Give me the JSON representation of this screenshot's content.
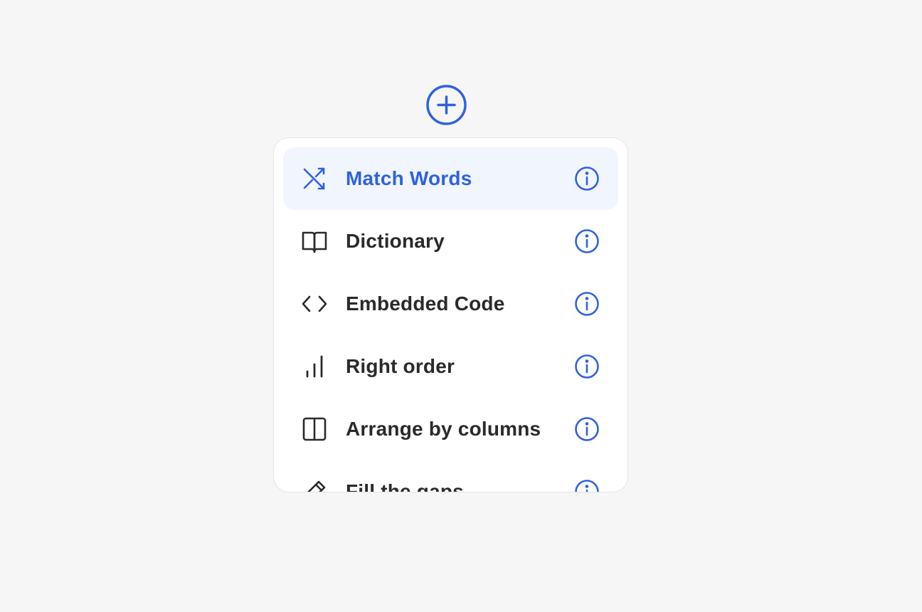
{
  "add_button": {
    "icon": "plus-circle-icon",
    "color": "#2f62e0"
  },
  "menu": {
    "items": [
      {
        "label": "Match Words",
        "icon": "shuffle-icon",
        "active": true
      },
      {
        "label": "Dictionary",
        "icon": "book-open-icon",
        "active": false
      },
      {
        "label": "Embedded Code",
        "icon": "code-brackets-icon",
        "active": false
      },
      {
        "label": "Right order",
        "icon": "bar-chart-icon",
        "active": false
      },
      {
        "label": "Arrange by columns",
        "icon": "columns-icon",
        "active": false
      },
      {
        "label": "Fill the gaps",
        "icon": "pencil-icon",
        "active": false
      }
    ],
    "info_icon": "info-icon"
  },
  "colors": {
    "accent": "#2f62e0",
    "active_bg": "#f1f5fd",
    "text": "#2a2a2a",
    "page_bg": "#f6f6f6",
    "card_bg": "#ffffff"
  }
}
